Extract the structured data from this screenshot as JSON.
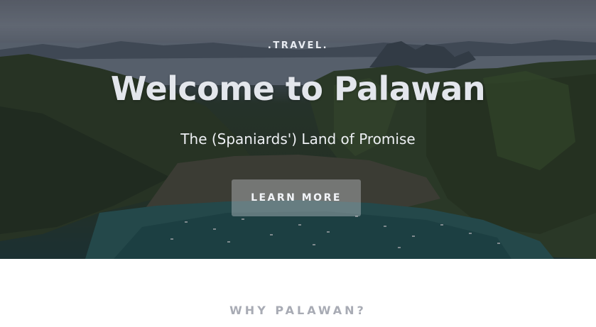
{
  "hero": {
    "eyebrow": ".TRAVEL.",
    "title": "Welcome to Palawan",
    "subtitle": "The (Spaniards') Land of Promise",
    "cta_label": "LEARN MORE"
  },
  "section": {
    "heading": "WHY PALAWAN?"
  },
  "colors": {
    "title": "#e3e6ec",
    "button_bg": "rgba(210,214,222,0.38)",
    "section_heading": "#a8abb4"
  }
}
